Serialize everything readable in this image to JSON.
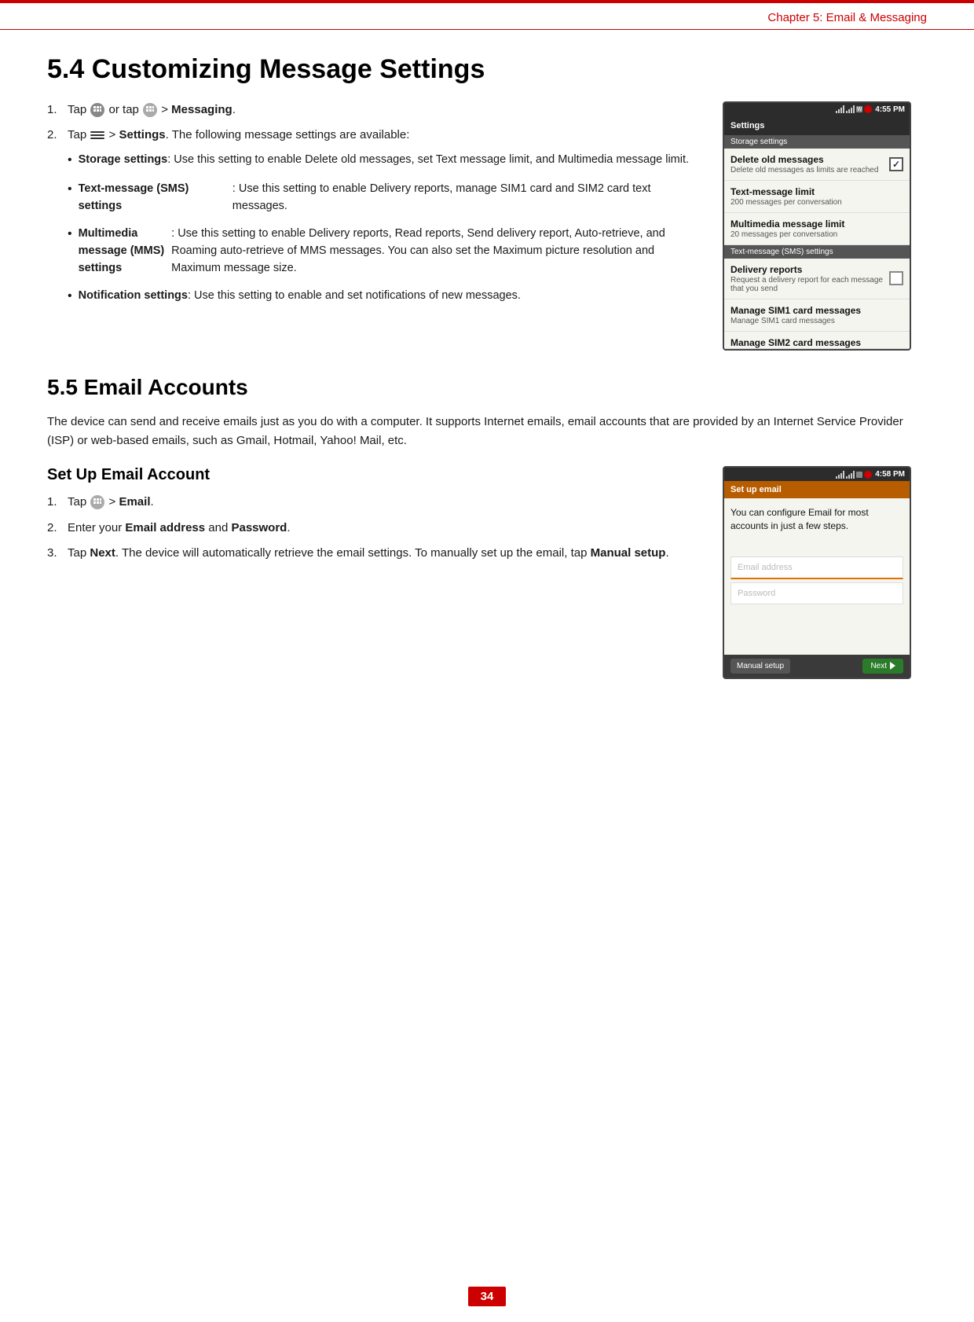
{
  "page": {
    "top_border_color": "#cc0000",
    "chapter_header": "Chapter 5: Email & Messaging",
    "page_number": "34"
  },
  "section_54": {
    "title": "5.4 Customizing Message Settings",
    "steps": [
      {
        "num": "1.",
        "text_before": "Tap",
        "icon1": "apps-icon",
        "text_middle": "or tap",
        "icon2": "apps2-icon",
        "text_after": "> Messaging.",
        "bold_part": "Messaging"
      },
      {
        "num": "2.",
        "text_before": "Tap",
        "icon": "menu-icon",
        "text_after": "> Settings. The following message settings are available:",
        "bold_part": "Settings"
      }
    ],
    "bullets": [
      {
        "bold": "Storage settings",
        "text": ": Use this setting to enable Delete old messages, set Text message limit, and Multimedia message limit."
      },
      {
        "bold": "Text-message (SMS) settings",
        "text": ": Use this setting to enable Delivery reports, manage SIM1 card and SIM2 card text messages."
      },
      {
        "bold": "Multimedia message (MMS) settings",
        "text": ": Use this setting to enable Delivery reports, Read reports, Send delivery report, Auto-retrieve, and Roaming auto-retrieve of MMS messages. You can also set the Maximum picture resolution and Maximum message size."
      },
      {
        "bold": "Notification settings",
        "text": ": Use this setting to enable and set notifications of new messages."
      }
    ],
    "screenshot": {
      "time": "4:55 PM",
      "title": "Settings",
      "section1": "Storage settings",
      "rows": [
        {
          "title": "Delete old messages",
          "subtitle": "Delete old messages as limits are reached",
          "has_check": true,
          "checked": true
        },
        {
          "title": "Text-message limit",
          "subtitle": "200 messages per conversation",
          "has_check": false,
          "checked": false
        },
        {
          "title": "Multimedia message limit",
          "subtitle": "20 messages per conversation",
          "has_check": false,
          "checked": false
        }
      ],
      "section2": "Text-message (SMS) settings",
      "rows2": [
        {
          "title": "Delivery reports",
          "subtitle": "Request a delivery report for each message that you send",
          "has_check": true,
          "checked": false
        },
        {
          "title": "Manage SIM1 card messages",
          "subtitle": "Manage SIM1 card messages",
          "has_check": false
        },
        {
          "title": "Manage SIM2 card messages",
          "subtitle": "",
          "has_check": false,
          "partial": true
        }
      ]
    }
  },
  "section_55": {
    "title": "5.5 Email Accounts",
    "body": "The device can send and receive emails just as you do with a computer. It supports Internet emails, email accounts that are provided by an Internet Service Provider (ISP) or web-based emails, such as Gmail, Hotmail, Yahoo! Mail, etc.",
    "sub_section": {
      "title": "Set Up Email Account",
      "steps": [
        {
          "num": "1.",
          "text": "Tap",
          "icon": "apps-icon",
          "text_after": "> Email.",
          "bold_part": "Email"
        },
        {
          "num": "2.",
          "text": "Enter your",
          "bold1": "Email address",
          "text_mid": "and",
          "bold2": "Password",
          "text_after": "."
        },
        {
          "num": "3.",
          "text": "Tap",
          "bold": "Next",
          "text_after": ". The device will automatically retrieve the email settings. To manually set up the email, tap",
          "bold2": "Manual setup",
          "text_end": "."
        }
      ],
      "screenshot": {
        "time": "4:58 PM",
        "title": "Set up email",
        "description": "You can configure Email for most accounts in just a few steps.",
        "input1_placeholder": "Email address",
        "input2_placeholder": "Password",
        "btn_manual": "Manual setup",
        "btn_next": "Next"
      }
    }
  }
}
